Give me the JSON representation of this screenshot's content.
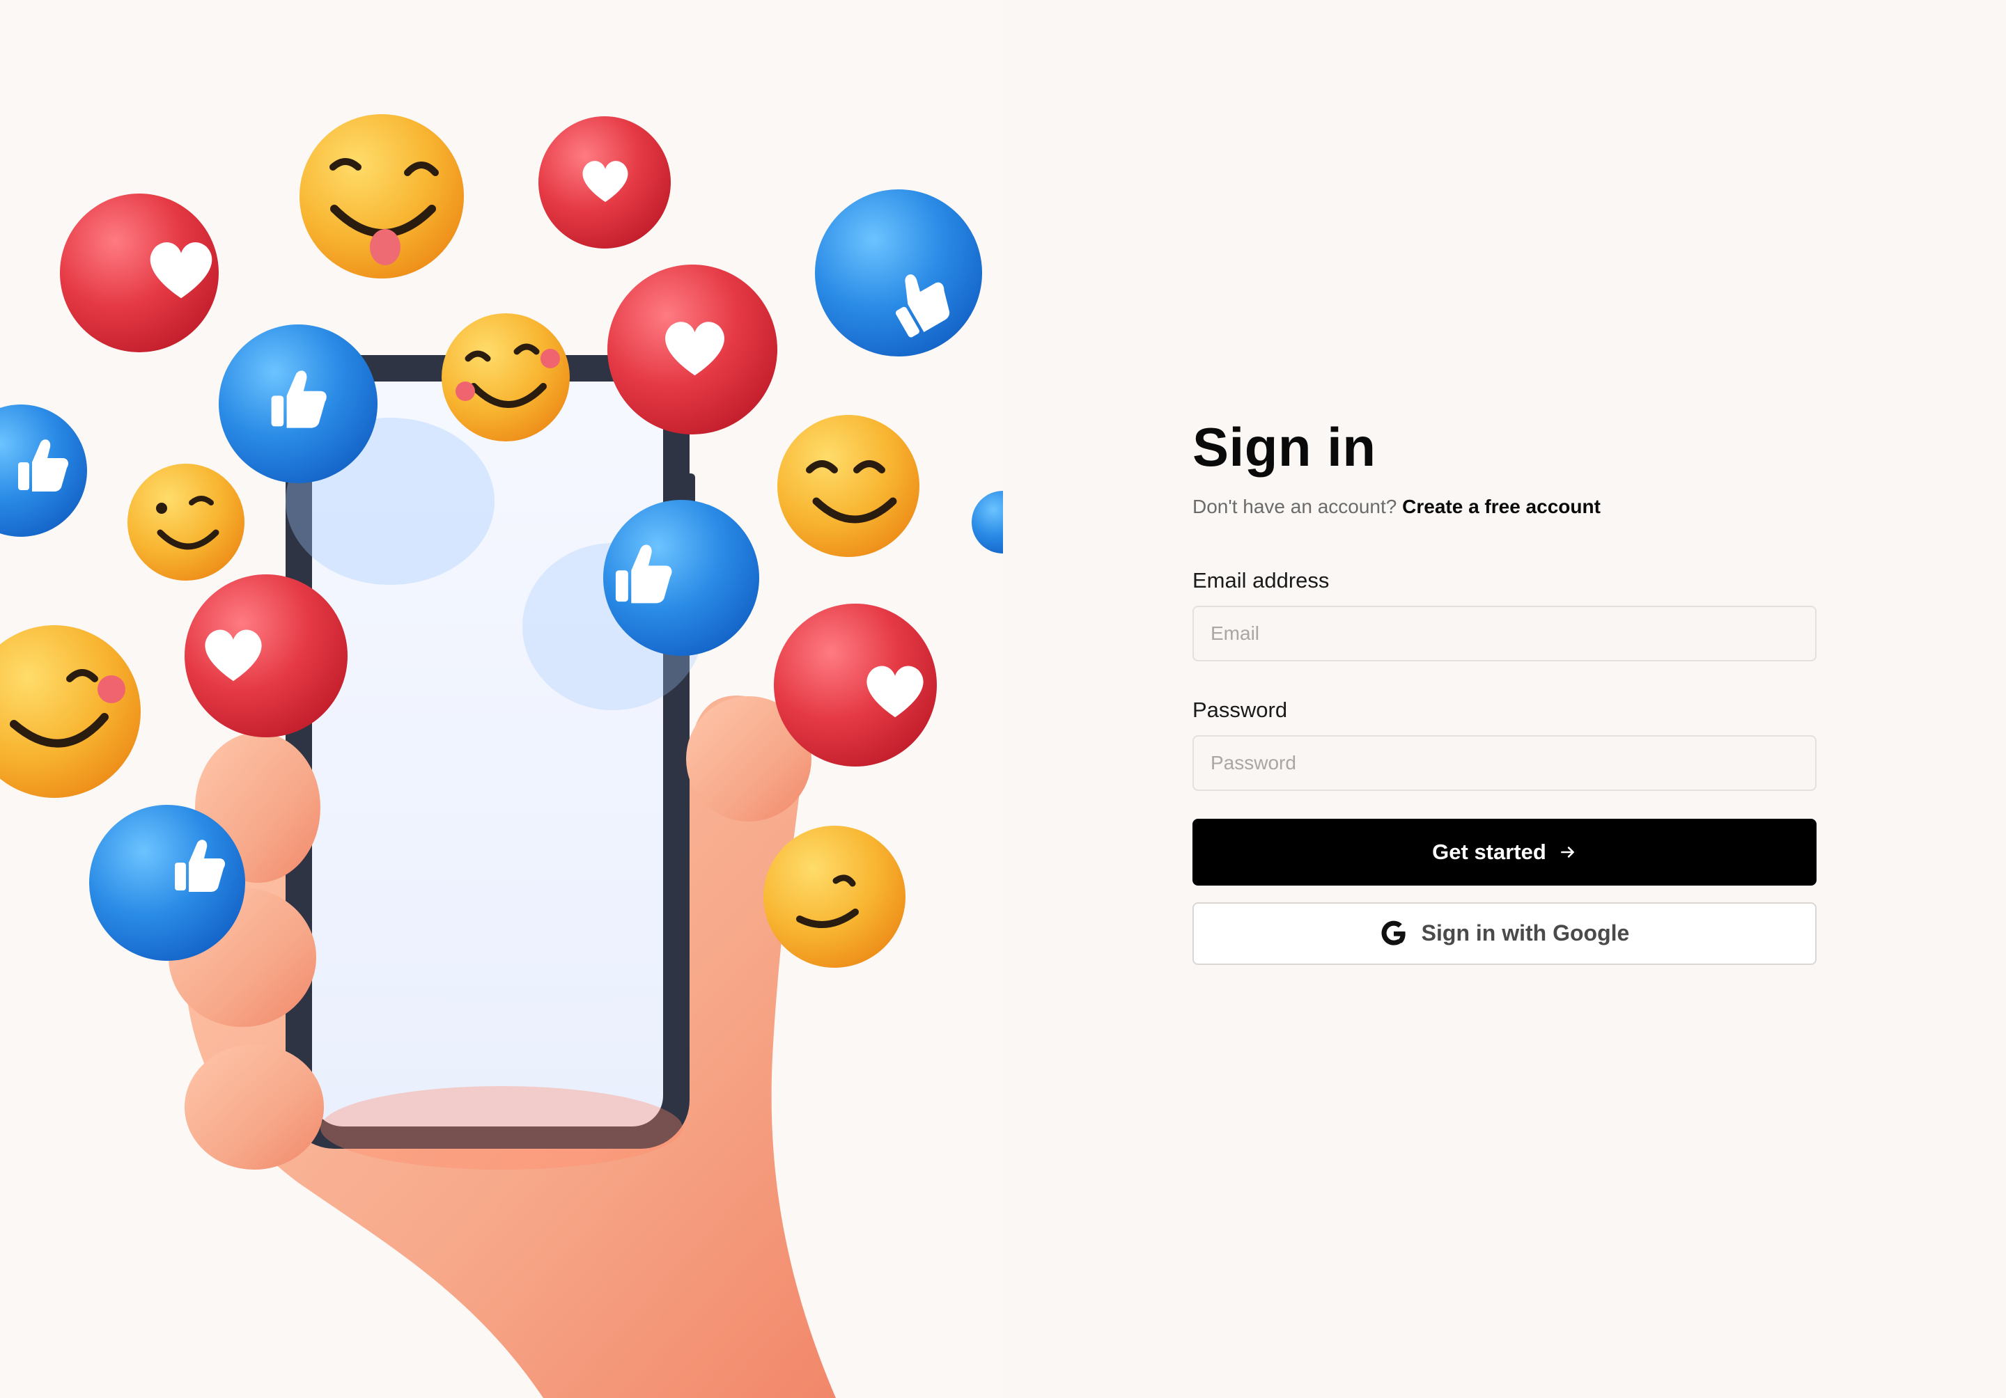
{
  "hero": {
    "illustration": "hand holding smartphone surrounded by like, heart and smiley emoji bubbles"
  },
  "signin": {
    "title": "Sign in",
    "no_account_text": "Don't have an account?",
    "create_account_link": "Create a free account",
    "email": {
      "label": "Email address",
      "placeholder": "Email",
      "value": ""
    },
    "password": {
      "label": "Password",
      "placeholder": "Password",
      "value": ""
    },
    "submit_label": "Get started",
    "submit_icon": "arrow-right-icon",
    "google_label": "Sign in with Google",
    "google_icon": "google-g-icon"
  },
  "colors": {
    "background": "#faf7f4",
    "primary_button": "#000000",
    "heart_red": "#e53a45",
    "like_blue": "#2a8be6",
    "smiley_yellow": "#f8b531",
    "hand_peach": "#f7a98a"
  }
}
